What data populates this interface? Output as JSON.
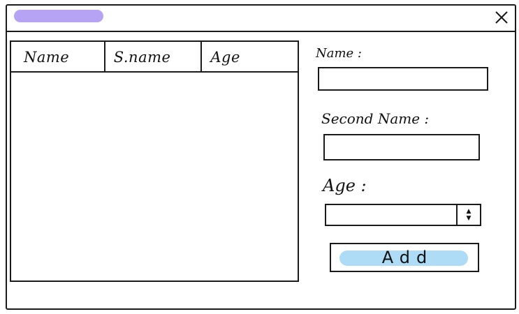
{
  "window": {
    "title": "",
    "title_color": "#b7a3f3"
  },
  "icons": {
    "close": "close-icon",
    "spinner_up": "arrow-up-icon",
    "spinner_down": "arrow-down-icon"
  },
  "table": {
    "columns": [
      "Name",
      "S.name",
      "Age"
    ],
    "rows": []
  },
  "form": {
    "name_label": "Name :",
    "name_value": "",
    "second_name_label": "Second Name :",
    "second_name_value": "",
    "age_label": "Age :",
    "age_value": "",
    "spinner_up_glyph": "▲",
    "spinner_down_glyph": "▼"
  },
  "actions": {
    "add_label": "Add",
    "add_color": "#aedcf6"
  }
}
